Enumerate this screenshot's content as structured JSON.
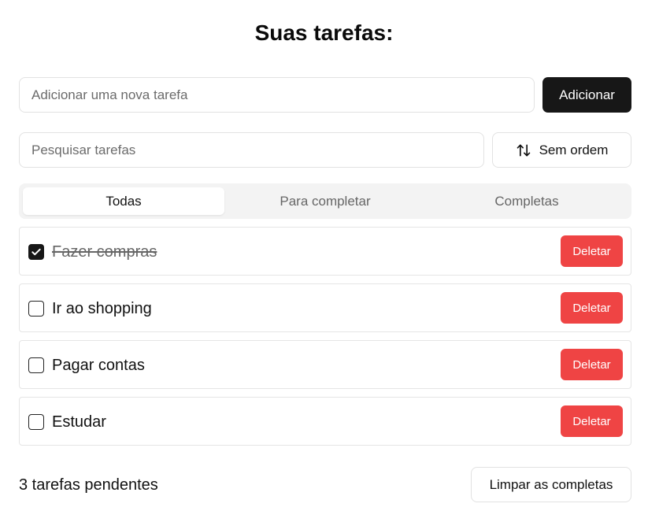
{
  "header": {
    "title": "Suas tarefas:"
  },
  "new_task": {
    "placeholder": "Adicionar uma nova tarefa",
    "value": "",
    "add_label": "Adicionar"
  },
  "search": {
    "placeholder": "Pesquisar tarefas",
    "value": "",
    "sort_label": "Sem ordem",
    "sort_icon": "sort-arrows-icon"
  },
  "tabs": [
    {
      "label": "Todas",
      "active": true
    },
    {
      "label": "Para completar",
      "active": false
    },
    {
      "label": "Completas",
      "active": false
    }
  ],
  "tasks": [
    {
      "label": "Fazer compras",
      "completed": true,
      "delete_label": "Deletar"
    },
    {
      "label": "Ir ao shopping",
      "completed": false,
      "delete_label": "Deletar"
    },
    {
      "label": "Pagar contas",
      "completed": false,
      "delete_label": "Deletar"
    },
    {
      "label": "Estudar",
      "completed": false,
      "delete_label": "Deletar"
    }
  ],
  "footer": {
    "pending_text": "3 tarefas pendentes",
    "clear_label": "Limpar as completas"
  },
  "colors": {
    "primary": "#171717",
    "danger": "#ef4444",
    "tabs_bg": "#f3f3f3",
    "border": "#e2e2e2"
  }
}
